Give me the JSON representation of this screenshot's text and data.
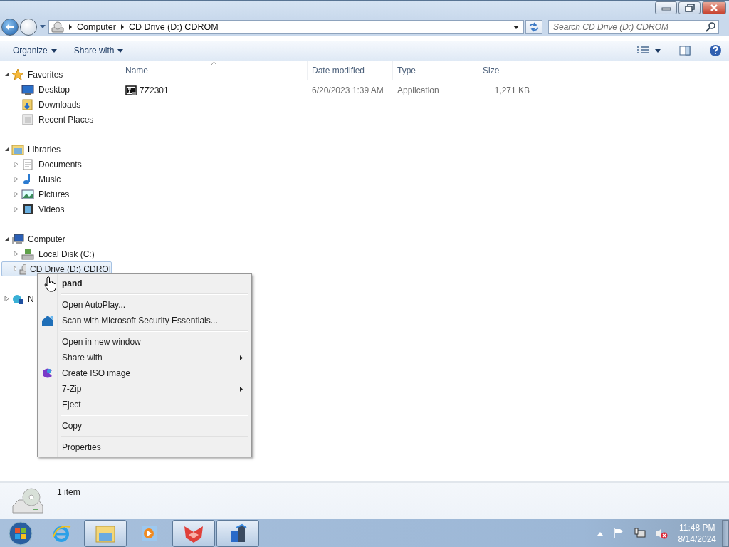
{
  "address_bar": {
    "segments": [
      "Computer",
      "CD Drive (D:) CDROM"
    ]
  },
  "search": {
    "placeholder": "Search CD Drive (D:) CDROM"
  },
  "toolbar": {
    "buttons": [
      "Organize",
      "Share with"
    ]
  },
  "sidebar": {
    "groups": [
      {
        "label": "Favorites",
        "expanded": true,
        "selected": false,
        "children": [
          {
            "label": "Desktop",
            "expandable": false,
            "selected": false
          },
          {
            "label": "Downloads",
            "expandable": false,
            "selected": false
          },
          {
            "label": "Recent Places",
            "expandable": false,
            "selected": false
          }
        ]
      },
      {
        "label": "Libraries",
        "expanded": true,
        "selected": false,
        "children": [
          {
            "label": "Documents",
            "expandable": true,
            "selected": false
          },
          {
            "label": "Music",
            "expandable": true,
            "selected": false
          },
          {
            "label": "Pictures",
            "expandable": true,
            "selected": false
          },
          {
            "label": "Videos",
            "expandable": true,
            "selected": false
          }
        ]
      },
      {
        "label": "Computer",
        "expanded": true,
        "selected": false,
        "children": [
          {
            "label": "Local Disk (C:)",
            "expandable": true,
            "selected": false
          },
          {
            "label": "CD Drive (D:) CDROI",
            "expandable": true,
            "selected": true
          }
        ]
      },
      {
        "label": "N",
        "expanded": false,
        "selected": false
      }
    ]
  },
  "table": {
    "columns": [
      "Name",
      "Date modified",
      "Type",
      "Size"
    ],
    "rows": [
      {
        "name": "7Z2301",
        "date_modified": "6/20/2023 1:39 AM",
        "type": "Application",
        "size": "1,271 KB"
      }
    ]
  },
  "context_menu": {
    "groups": [
      [
        {
          "label": "pand",
          "kind": "default"
        }
      ],
      [
        {
          "label": "Open AutoPlay...",
          "kind": "plain"
        },
        {
          "label": "Scan with Microsoft Security Essentials...",
          "kind": "scan"
        }
      ],
      [
        {
          "label": "Open in new window",
          "kind": "plain"
        },
        {
          "label": "Share with",
          "kind": "submenu"
        },
        {
          "label": "Create ISO image",
          "kind": "iso"
        },
        {
          "label": "7-Zip",
          "kind": "submenu"
        },
        {
          "label": "Eject",
          "kind": "plain"
        }
      ],
      [
        {
          "label": "Copy",
          "kind": "plain"
        }
      ],
      [
        {
          "label": "Properties",
          "kind": "plain"
        }
      ]
    ]
  },
  "details_pane": {
    "text": "1 item"
  },
  "taskbar": {
    "apps": [
      {
        "active": false
      },
      {
        "active": true
      },
      {
        "active": false
      },
      {
        "active": true
      },
      {
        "active": true
      }
    ],
    "clock": {
      "time": "11:48 PM",
      "date": "8/14/2024"
    }
  }
}
